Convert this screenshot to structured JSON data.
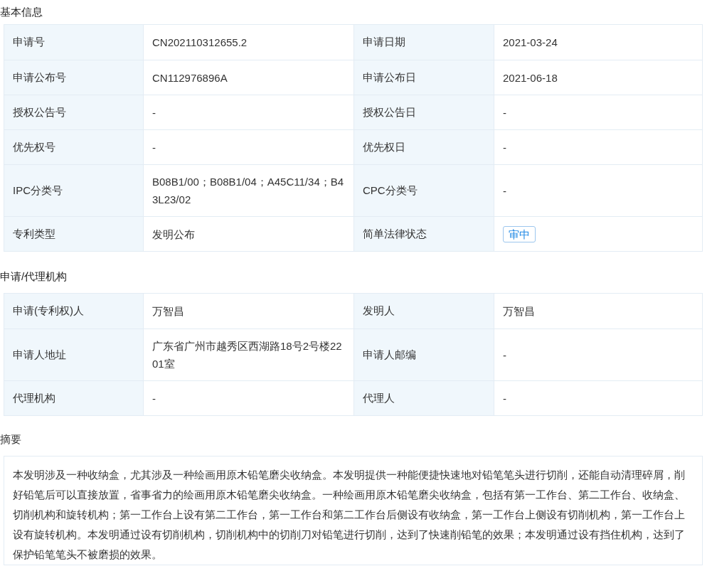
{
  "sections": [
    {
      "title": "基本信息",
      "rows": [
        [
          {
            "label": "申请号",
            "value": "CN202110312655.2",
            "kind": "text"
          },
          {
            "label": "申请日期",
            "value": "2021-03-24",
            "kind": "text"
          }
        ],
        [
          {
            "label": "申请公布号",
            "value": "CN112976896A",
            "kind": "text"
          },
          {
            "label": "申请公布日",
            "value": "2021-06-18",
            "kind": "text"
          }
        ],
        [
          {
            "label": "授权公告号",
            "value": "-",
            "kind": "text"
          },
          {
            "label": "授权公告日",
            "value": "-",
            "kind": "text"
          }
        ],
        [
          {
            "label": "优先权号",
            "value": "-",
            "kind": "text"
          },
          {
            "label": "优先权日",
            "value": "-",
            "kind": "text"
          }
        ],
        [
          {
            "label": "IPC分类号",
            "value": "B08B1/00；B08B1/04；A45C11/34；B43L23/02",
            "kind": "text"
          },
          {
            "label": "CPC分类号",
            "value": "-",
            "kind": "text"
          }
        ],
        [
          {
            "label": "专利类型",
            "value": "发明公布",
            "kind": "text"
          },
          {
            "label": "简单法律状态",
            "value": "审中",
            "kind": "tag"
          }
        ]
      ]
    },
    {
      "title": "申请/代理机构",
      "rows": [
        [
          {
            "label": "申请(专利权)人",
            "value": "万智昌",
            "kind": "text"
          },
          {
            "label": "发明人",
            "value": "万智昌",
            "kind": "text"
          }
        ],
        [
          {
            "label": "申请人地址",
            "value": "广东省广州市越秀区西湖路18号2号楼2201室",
            "kind": "text"
          },
          {
            "label": "申请人邮编",
            "value": "-",
            "kind": "text"
          }
        ],
        [
          {
            "label": "代理机构",
            "value": "-",
            "kind": "text"
          },
          {
            "label": "代理人",
            "value": "-",
            "kind": "text"
          }
        ]
      ]
    }
  ],
  "abstract": {
    "title": "摘要",
    "text": "本发明涉及一种收纳盒，尤其涉及一种绘画用原木铅笔磨尖收纳盒。本发明提供一种能便捷快速地对铅笔笔头进行切削，还能自动清理碎屑，削好铅笔后可以直接放置，省事省力的绘画用原木铅笔磨尖收纳盒。一种绘画用原木铅笔磨尖收纳盒，包括有第一工作台、第二工作台、收纳盒、切削机构和旋转机构；第一工作台上设有第二工作台，第一工作台和第二工作台后侧设有收纳盒，第一工作台上侧设有切削机构，第一工作台上设有旋转机构。本发明通过设有切削机构，切削机构中的切削刀对铅笔进行切削，达到了快速削铅笔的效果；本发明通过设有挡住机构，达到了保护铅笔笔头不被磨损的效果。"
  }
}
